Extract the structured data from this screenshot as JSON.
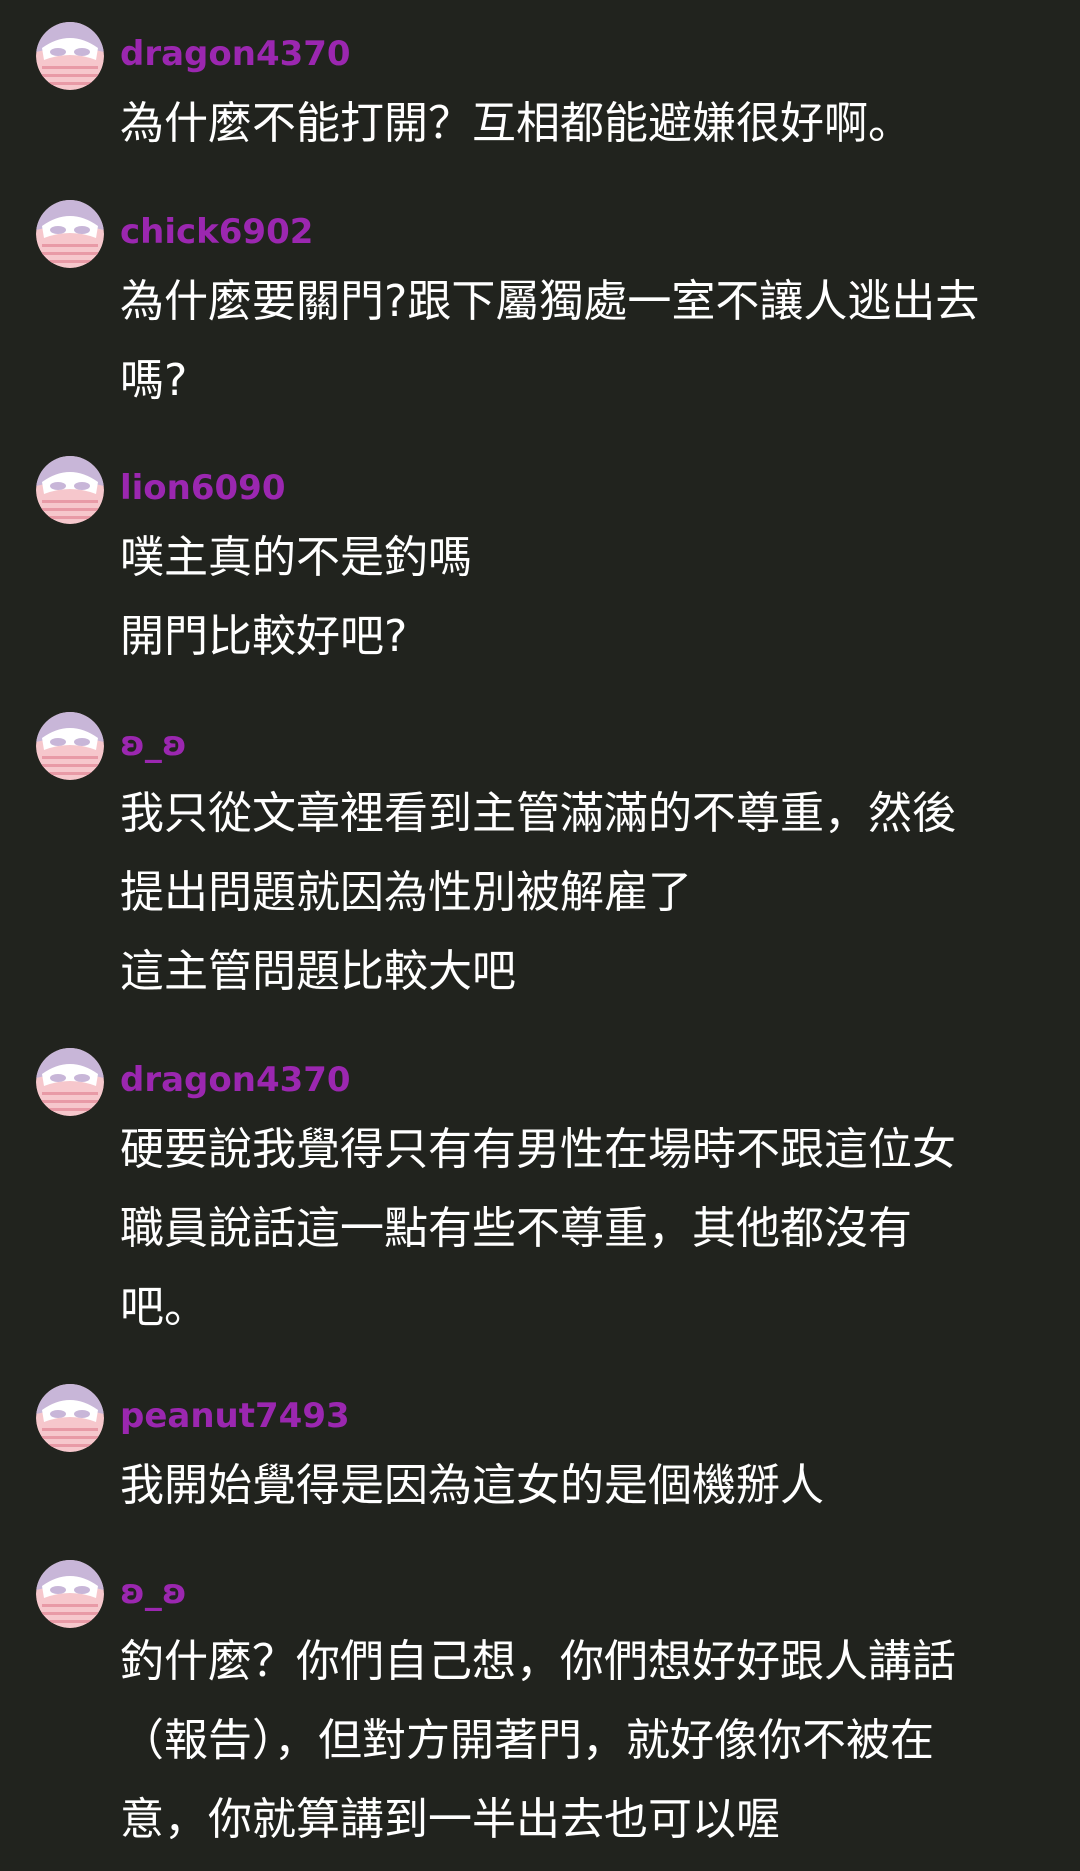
{
  "comments": [
    {
      "username": "dragon4370",
      "lines": [
        "為什麼不能打開？互相都能避嫌很好啊。"
      ]
    },
    {
      "username": "chick6902",
      "lines": [
        "為什麼要關門?跟下屬獨處一室不讓人逃出去",
        "嗎?"
      ]
    },
    {
      "username": "lion6090",
      "lines": [
        "噗主真的不是釣嗎",
        "開門比較好吧?"
      ]
    },
    {
      "username": "ʚ_ʚ",
      "lines": [
        "我只從文章裡看到主管滿滿的不尊重，然後",
        "提出問題就因為性別被解雇了",
        "這主管問題比較大吧"
      ]
    },
    {
      "username": "dragon4370",
      "lines": [
        "硬要說我覺得只有有男性在場時不跟這位女",
        "職員說話這一點有些不尊重，其他都沒有",
        "吧。"
      ]
    },
    {
      "username": "peanut7493",
      "lines": [
        "我開始覺得是因為這女的是個機掰人"
      ]
    },
    {
      "username": "ʚ_ʚ",
      "lines": [
        "釣什麼？你們自己想，你們想好好跟人講話",
        "（報告），但對方開著門，就好像你不被在",
        "意，你就算講到一半出去也可以喔"
      ]
    }
  ],
  "avatar_icon": "masked-face-avatar-icon",
  "colors": {
    "background": "#21231e",
    "username": "#9b27b0",
    "text": "#ffffff",
    "avatar_bg": "#f6c7cc",
    "avatar_mask": "#c8b6d8"
  }
}
